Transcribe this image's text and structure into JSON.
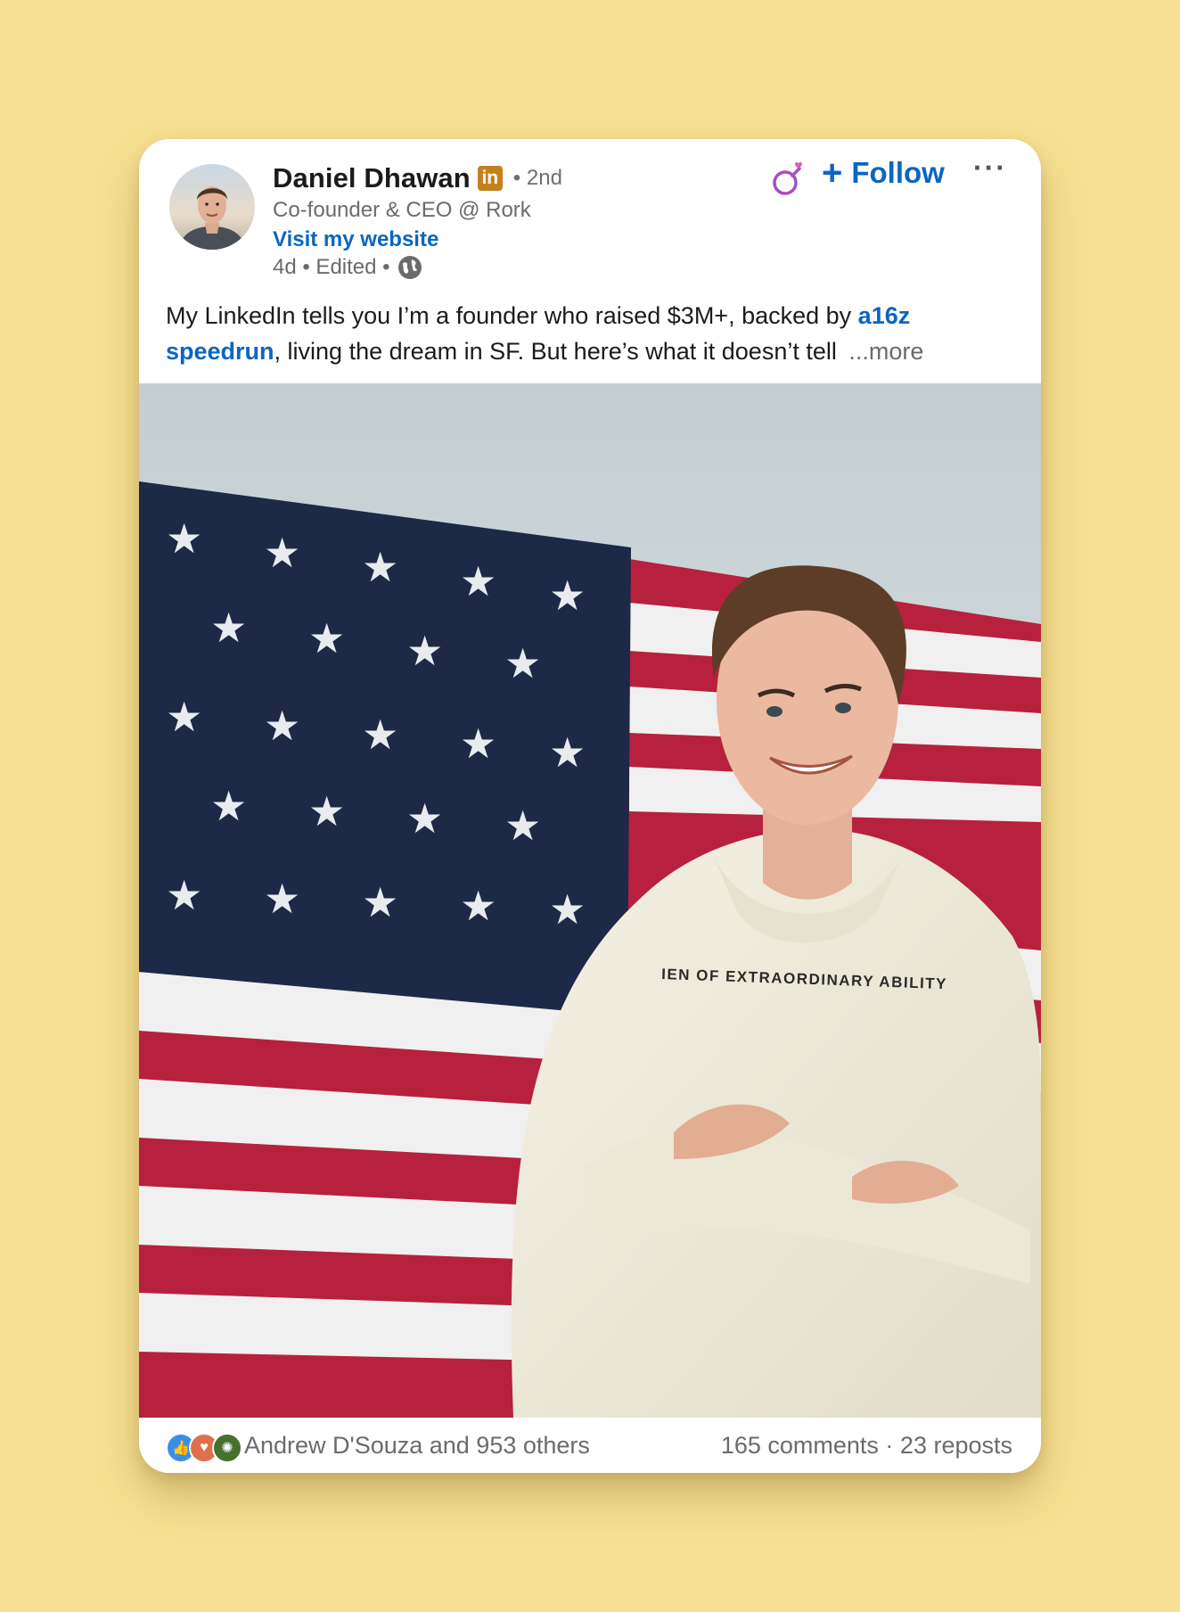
{
  "author": {
    "name": "Daniel Dhawan",
    "badge": "in",
    "degree": "• 2nd",
    "headline": "Co-founder & CEO @ Rork",
    "website_label": "Visit my website",
    "meta": "4d • Edited •"
  },
  "actions": {
    "follow_plus": "+",
    "follow_label": "Follow",
    "more_label": "···"
  },
  "post": {
    "text_part1": "My LinkedIn tells you I’m a founder who raised $3M+, backed by ",
    "link_text": "a16z speedrun",
    "text_part2": ", living the dream in SF. But here’s what it doesn’t tell ",
    "see_more": "...more"
  },
  "photo": {
    "sweatshirt_text": "IEN OF EXTRAORDINARY ABILITY"
  },
  "social": {
    "reactions": [
      "like-icon",
      "love-icon",
      "celebrate-icon"
    ],
    "reactors": "Andrew D'Souza and 953 others",
    "comments": "165 comments",
    "separator": " · ",
    "reposts": "23 reposts"
  },
  "colors": {
    "background": "#f8e092",
    "link": "#0a66c2",
    "badge": "#c3801d"
  }
}
